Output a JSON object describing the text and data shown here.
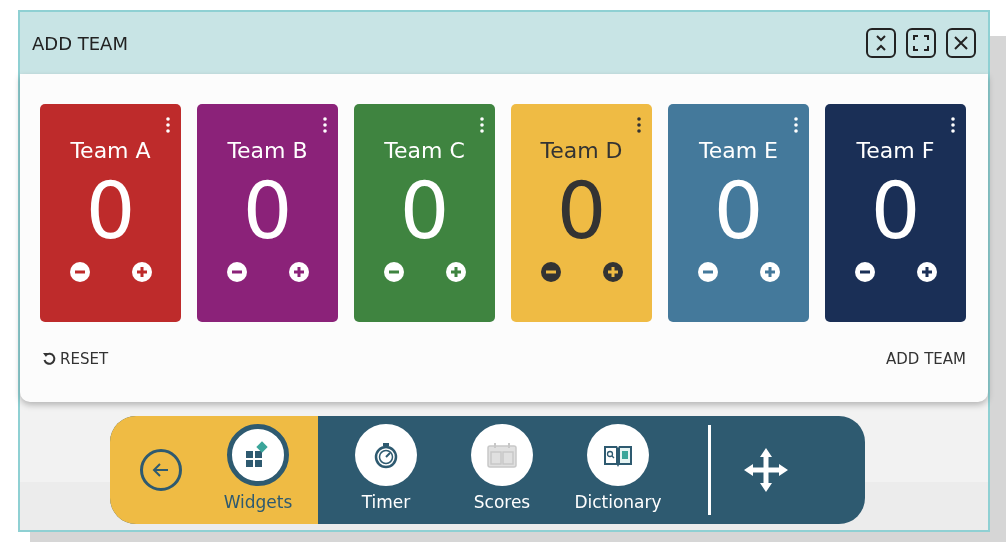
{
  "window": {
    "title": "ADD TEAM"
  },
  "teams": [
    {
      "name": "Team A",
      "score": "0",
      "color": "#be2b2b"
    },
    {
      "name": "Team B",
      "score": "0",
      "color": "#8b2279"
    },
    {
      "name": "Team C",
      "score": "0",
      "color": "#3f8440"
    },
    {
      "name": "Team D",
      "score": "0",
      "color": "#efbb44"
    },
    {
      "name": "Team E",
      "score": "0",
      "color": "#44799b"
    },
    {
      "name": "Team F",
      "score": "0",
      "color": "#1a2f56"
    }
  ],
  "actions": {
    "reset": "RESET",
    "add": "ADD TEAM"
  },
  "toolbar": {
    "tools": [
      {
        "kind": "widgets",
        "label": "Widgets",
        "selected": true
      },
      {
        "kind": "timer",
        "label": "Timer",
        "selected": false
      },
      {
        "kind": "scores",
        "label": "Scores",
        "selected": false
      },
      {
        "kind": "dictionary",
        "label": "Dictionary",
        "selected": false
      }
    ]
  }
}
